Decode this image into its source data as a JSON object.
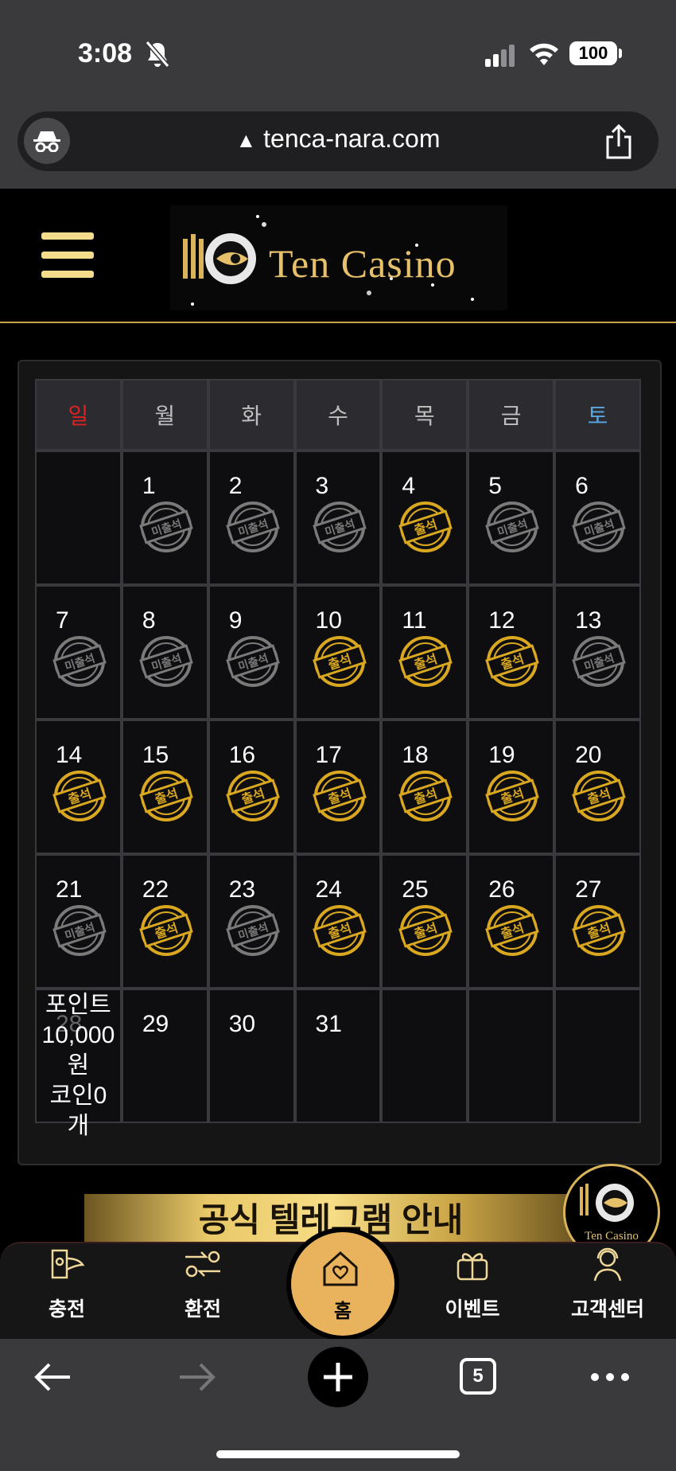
{
  "status_bar": {
    "time": "3:08",
    "battery": "100"
  },
  "browser": {
    "url": "tenca-nara.com",
    "tabs_count": "5"
  },
  "header": {
    "logo_text": "Ten Casino"
  },
  "calendar": {
    "weekdays": [
      "일",
      "월",
      "화",
      "수",
      "목",
      "금",
      "토"
    ],
    "weeks": [
      [
        null,
        {
          "day": "1",
          "status": "미출석"
        },
        {
          "day": "2",
          "status": "미출석"
        },
        {
          "day": "3",
          "status": "미출석"
        },
        {
          "day": "4",
          "status": "출석"
        },
        {
          "day": "5",
          "status": "미출석"
        },
        {
          "day": "6",
          "status": "미출석"
        }
      ],
      [
        {
          "day": "7",
          "status": "미출석"
        },
        {
          "day": "8",
          "status": "미출석"
        },
        {
          "day": "9",
          "status": "미출석"
        },
        {
          "day": "10",
          "status": "출석"
        },
        {
          "day": "11",
          "status": "출석"
        },
        {
          "day": "12",
          "status": "출석"
        },
        {
          "day": "13",
          "status": "미출석"
        }
      ],
      [
        {
          "day": "14",
          "status": "출석"
        },
        {
          "day": "15",
          "status": "출석"
        },
        {
          "day": "16",
          "status": "출석"
        },
        {
          "day": "17",
          "status": "출석"
        },
        {
          "day": "18",
          "status": "출석"
        },
        {
          "day": "19",
          "status": "출석"
        },
        {
          "day": "20",
          "status": "출석"
        }
      ],
      [
        {
          "day": "21",
          "status": "미출석"
        },
        {
          "day": "22",
          "status": "출석"
        },
        {
          "day": "23",
          "status": "미출석"
        },
        {
          "day": "24",
          "status": "출석"
        },
        {
          "day": "25",
          "status": "출석"
        },
        {
          "day": "26",
          "status": "출석"
        },
        {
          "day": "27",
          "status": "출석"
        }
      ],
      [
        {
          "day": "28",
          "status": "",
          "note": [
            "포인트",
            "10,000",
            "원",
            "코인0",
            "개"
          ]
        },
        {
          "day": "29",
          "status": ""
        },
        {
          "day": "30",
          "status": ""
        },
        {
          "day": "31",
          "status": ""
        },
        null,
        null,
        null
      ]
    ]
  },
  "banner": {
    "text": "공식 텔레그램 안내"
  },
  "bottom_nav": {
    "items": [
      {
        "label": "충전",
        "icon": "charge-icon"
      },
      {
        "label": "환전",
        "icon": "exchange-icon"
      },
      {
        "label": "홈",
        "icon": "home-icon"
      },
      {
        "label": "이벤트",
        "icon": "gift-icon"
      },
      {
        "label": "고객센터",
        "icon": "support-icon"
      }
    ]
  },
  "colors": {
    "gold": "#e9b25c",
    "sunday": "#dd2222",
    "saturday": "#5aa8e0",
    "attended": "#d9a820",
    "absent": "#7a7a7a"
  }
}
